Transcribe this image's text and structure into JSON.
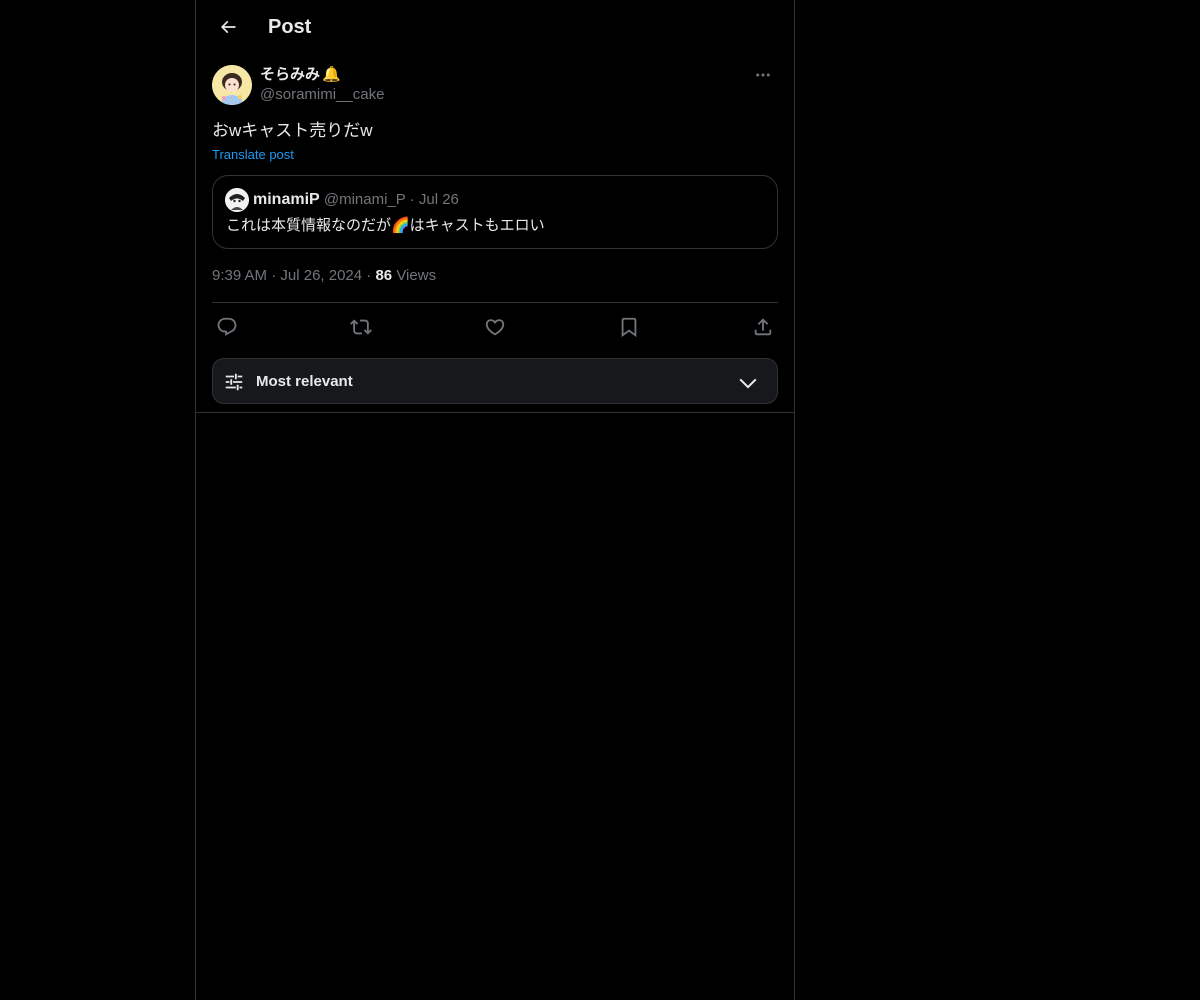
{
  "header": {
    "title": "Post",
    "back_icon": "arrow-left-icon"
  },
  "post": {
    "author": {
      "display_name": "そらみみ",
      "badge_emoji": "🔔",
      "handle": "@soramimi__cake",
      "avatar_icon": "user-avatar"
    },
    "more_icon": "more-horizontal-icon",
    "text": "おwキャスト売りだw",
    "translate_label": "Translate post",
    "quoted": {
      "display_name": "minamiP",
      "handle": "@minami_P",
      "separator": "·",
      "date": "Jul 26",
      "text": "これは本質情報なのだが🌈はキャストもエロい"
    },
    "meta": {
      "time": "9:39 AM",
      "separator": "·",
      "date": "Jul 26, 2024",
      "views_count": "86",
      "views_label": "Views"
    },
    "actions": [
      {
        "name": "reply",
        "icon": "reply-icon"
      },
      {
        "name": "repost",
        "icon": "repost-icon"
      },
      {
        "name": "like",
        "icon": "heart-icon"
      },
      {
        "name": "bookmark",
        "icon": "bookmark-icon"
      },
      {
        "name": "share",
        "icon": "share-icon"
      }
    ]
  },
  "sort": {
    "label": "Most relevant",
    "icon": "sliders-icon",
    "chevron": "chevron-down-icon"
  },
  "colors": {
    "background": "#000000",
    "text": "#e7e9ea",
    "muted": "#71767b",
    "border": "#2f3336",
    "accent": "#1d9bf0"
  }
}
